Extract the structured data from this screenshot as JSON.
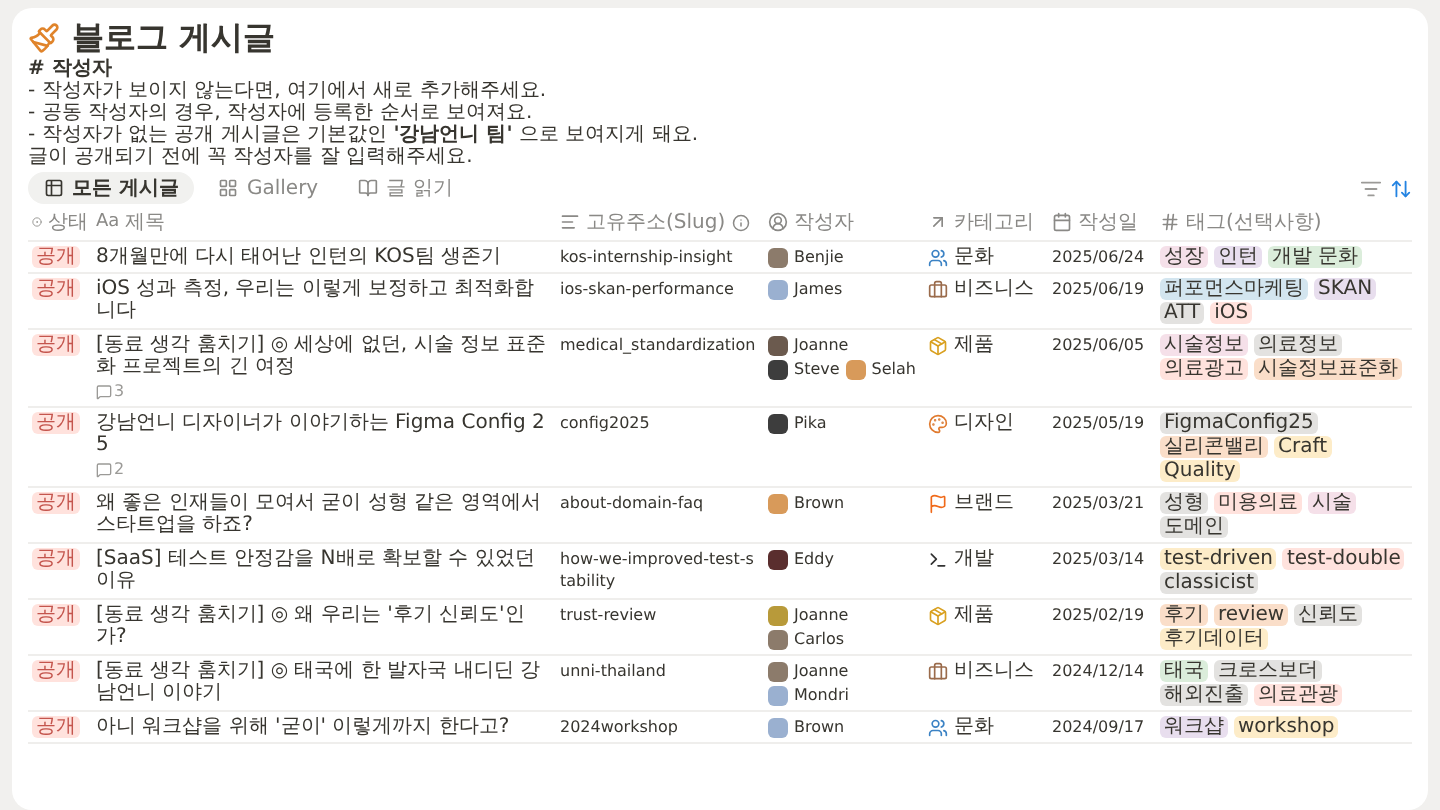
{
  "page": {
    "title": "블로그 게시글",
    "notes_heading": "# 작성자",
    "notes": [
      "- 작성자가 보이지 않는다면, 여기에서 새로 추가해주세요.",
      "- 공동 작성자의 경우, 작성자에 등록한 순서로 보여져요.",
      "- 작성자가 없는 공개 게시글은 기본값인 **'강남언니 팀'** 으로 보여지게 돼요.",
      "글이 공개되기 전에 꼭 작성자를 잘 입력해주세요."
    ]
  },
  "views": [
    {
      "label": "모든 게시글",
      "kind": "table",
      "selected": true
    },
    {
      "label": "Gallery",
      "kind": "gallery",
      "selected": false
    },
    {
      "label": "글 읽기",
      "kind": "list",
      "selected": false
    }
  ],
  "columns": [
    {
      "kind": "status",
      "label": "상태"
    },
    {
      "kind": "title",
      "glyph": "Aa",
      "label": "제목"
    },
    {
      "kind": "slug",
      "label": "고유주소(Slug)"
    },
    {
      "kind": "person",
      "label": "작성자"
    },
    {
      "kind": "relation",
      "label": "카테고리"
    },
    {
      "kind": "date",
      "label": "작성일"
    },
    {
      "kind": "tags",
      "label": "태그(선택사항)"
    }
  ],
  "rows": [
    {
      "status": "공개",
      "title": "8개월만에 다시 태어난 인턴의 KOS팀 생존기",
      "slug": "kos-internship-insight",
      "authors": [
        "Benjie"
      ],
      "category": {
        "kind": "culture",
        "label": "문화"
      },
      "date": "2025/06/24",
      "tags": [
        {
          "label": "성장",
          "color": "#f5e0e9"
        },
        {
          "label": "인턴",
          "color": "#e8deee"
        },
        {
          "label": "개발 문화",
          "color": "#dbeddb"
        }
      ]
    },
    {
      "status": "공개",
      "title": "iOS 성과 측정, 우리는 이렇게 보정하고 최적화합니다",
      "slug": "ios-skan-performance",
      "authors": [
        "James"
      ],
      "category": {
        "kind": "business",
        "label": "비즈니스"
      },
      "date": "2025/06/19",
      "tags": [
        {
          "label": "퍼포먼스마케팅",
          "color": "#d3e5ef"
        },
        {
          "label": "SKAN",
          "color": "#e8deee"
        },
        {
          "label": "ATT",
          "color": "#e3e2e0"
        },
        {
          "label": "iOS",
          "color": "#ffe2dd"
        }
      ]
    },
    {
      "status": "공개",
      "title": "[동료 생각 훔치기] ◎ 세상에 없던, 시술 정보 표준화 프로젝트의 긴 여정",
      "comments": "3",
      "slug": "medical_standardization",
      "authors": [
        "Joanne",
        "Steve",
        "Selah"
      ],
      "category": {
        "kind": "product",
        "label": "제품"
      },
      "date": "2025/06/05",
      "tags": [
        {
          "label": "시술정보",
          "color": "#f5e0e9"
        },
        {
          "label": "의료정보",
          "color": "#e3e2e0"
        },
        {
          "label": "의료광고",
          "color": "#ffe2dd"
        },
        {
          "label": "시술정보표준화",
          "color": "#fadec9"
        }
      ]
    },
    {
      "status": "공개",
      "title": "강남언니 디자이너가 이야기하는 Figma Config 25",
      "comments": "2",
      "slug": "config2025",
      "authors": [
        "Pika"
      ],
      "category": {
        "kind": "design",
        "label": "디자인"
      },
      "date": "2025/05/19",
      "tags": [
        {
          "label": "FigmaConfig25",
          "color": "#e3e2e0"
        },
        {
          "label": "실리콘밸리",
          "color": "#fadec9"
        },
        {
          "label": "Craft",
          "color": "#fdecc8"
        },
        {
          "label": "Quality",
          "color": "#fdecc8"
        }
      ]
    },
    {
      "status": "공개",
      "title": "왜 좋은 인재들이 모여서 굳이 성형 같은 영역에서 스타트업을 하죠?",
      "slug": "about-domain-faq",
      "authors": [
        "Brown"
      ],
      "category": {
        "kind": "brand",
        "label": "브랜드"
      },
      "date": "2025/03/21",
      "tags": [
        {
          "label": "성형",
          "color": "#e3e2e0"
        },
        {
          "label": "미용의료",
          "color": "#ffe2dd"
        },
        {
          "label": "시술",
          "color": "#f5e0e9"
        },
        {
          "label": "도메인",
          "color": "#e3e2e0"
        }
      ]
    },
    {
      "status": "공개",
      "title": "[SaaS] 테스트 안정감을 N배로 확보할 수 있었던 이유",
      "slug": "how-we-improved-test-stability",
      "authors": [
        "Eddy"
      ],
      "category": {
        "kind": "dev",
        "label": "개발"
      },
      "date": "2025/03/14",
      "tags": [
        {
          "label": "test-driven",
          "color": "#fdecc8"
        },
        {
          "label": "test-double",
          "color": "#ffe2dd"
        },
        {
          "label": "classicist",
          "color": "#e3e2e0"
        }
      ]
    },
    {
      "status": "공개",
      "title": "[동료 생각 훔치기] ◎ 왜 우리는 '후기 신뢰도'인가?",
      "slug": "trust-review",
      "authors": [
        "Joanne",
        "Carlos"
      ],
      "category": {
        "kind": "product",
        "label": "제품"
      },
      "date": "2025/02/19",
      "tags": [
        {
          "label": "후기",
          "color": "#fadec9"
        },
        {
          "label": "review",
          "color": "#fadec9"
        },
        {
          "label": "신뢰도",
          "color": "#e3e2e0"
        },
        {
          "label": "후기데이터",
          "color": "#fdecc8"
        }
      ]
    },
    {
      "status": "공개",
      "title": "[동료 생각 훔치기] ◎ 태국에 한 발자국 내디딘 강남언니 이야기",
      "slug": "unni-thailand",
      "authors": [
        "Joanne",
        "Mondri"
      ],
      "category": {
        "kind": "business",
        "label": "비즈니스"
      },
      "date": "2024/12/14",
      "tags": [
        {
          "label": "태국",
          "color": "#dbeddb"
        },
        {
          "label": "크로스보더",
          "color": "#e3e2e0"
        },
        {
          "label": "해외진출",
          "color": "#e3e2e0"
        },
        {
          "label": "의료관광",
          "color": "#ffe2dd"
        }
      ]
    },
    {
      "status": "공개",
      "title": "아니 워크샵을 위해 '굳이' 이렇게까지 한다고?",
      "slug": "2024workshop",
      "authors": [
        "Brown"
      ],
      "category": {
        "kind": "culture",
        "label": "문화"
      },
      "date": "2024/09/17",
      "tags": [
        {
          "label": "워크샵",
          "color": "#e8deee"
        },
        {
          "label": "workshop",
          "color": "#fdecc8"
        }
      ]
    }
  ]
}
